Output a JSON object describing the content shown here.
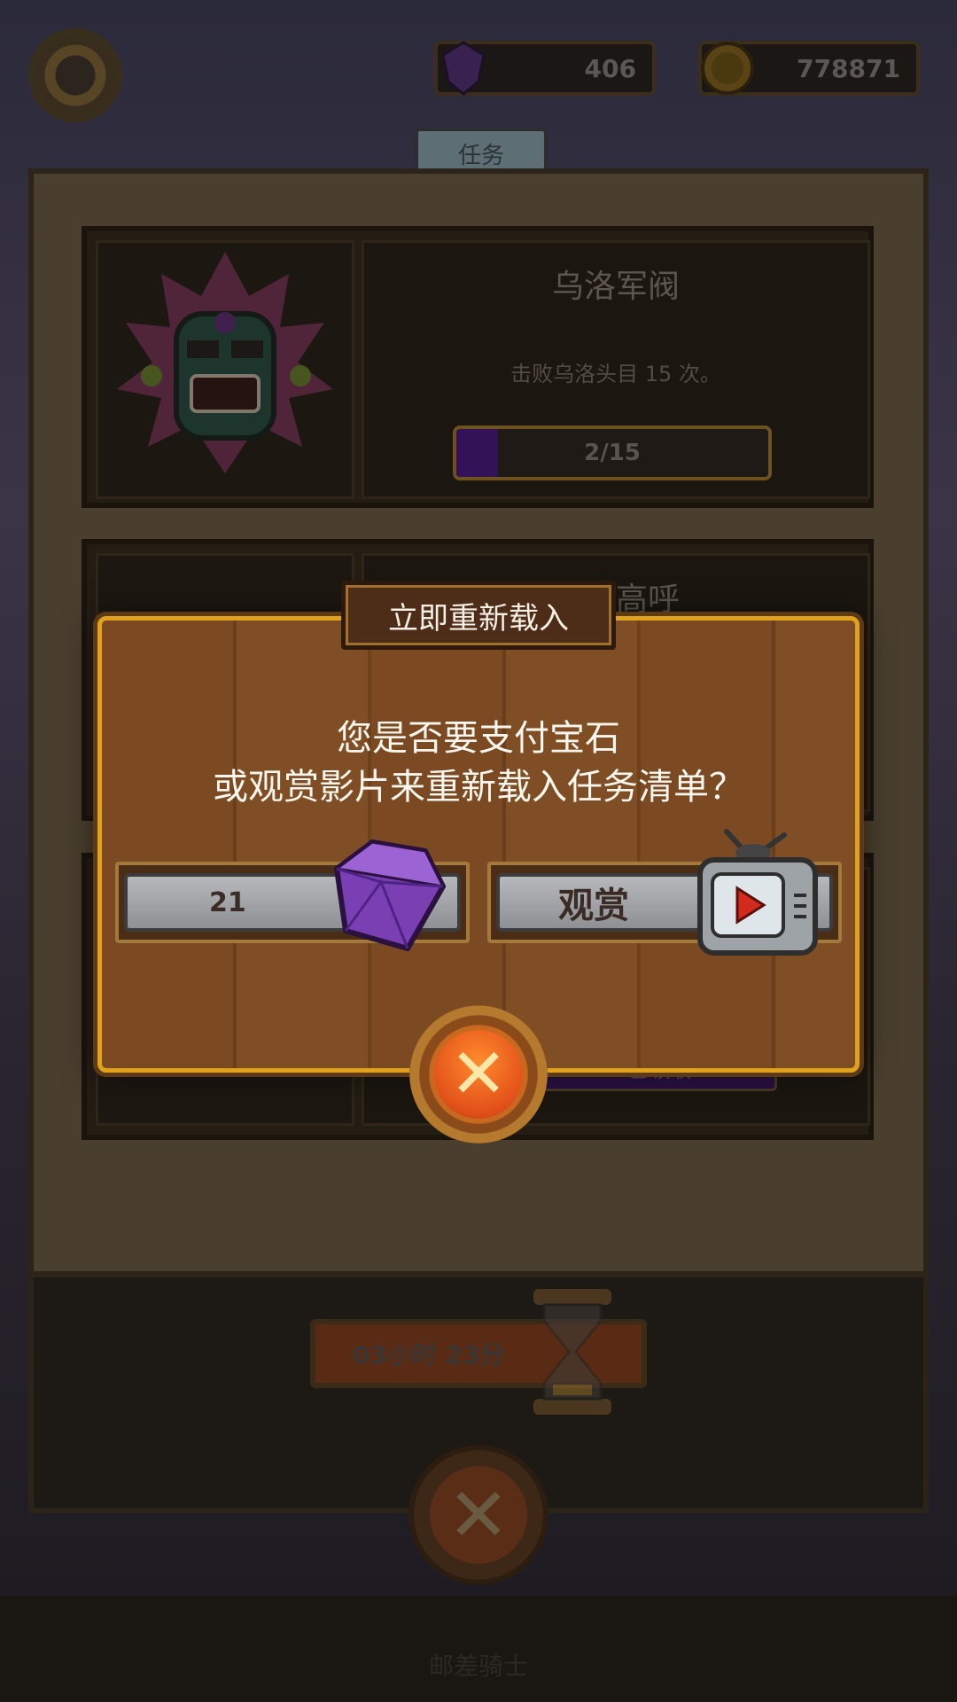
{
  "hud": {
    "gems": "406",
    "coins": "778871"
  },
  "tab_title": "任务",
  "missions": [
    {
      "title": "乌洛军阀",
      "desc": "击败乌洛头目 15 次。",
      "progress_text": "2/15",
      "progress": 0.133
    },
    {
      "title": "呜呜高呼"
    },
    {
      "claimed_label": "已领取"
    }
  ],
  "timer": "03小时 23分",
  "footer_label": "邮差骑士",
  "dialog": {
    "title": "立即重新载入",
    "line1": "您是否要支付宝石",
    "line2": "或观赏影片来重新载入任务清单？",
    "gem_cost": "21",
    "watch_label": "观赏"
  },
  "colors": {
    "dialog_border": "#e0a21d",
    "wood": "#7b4a22",
    "gem_purple": "#7a3fb3",
    "close_orange": "#e2501a"
  }
}
